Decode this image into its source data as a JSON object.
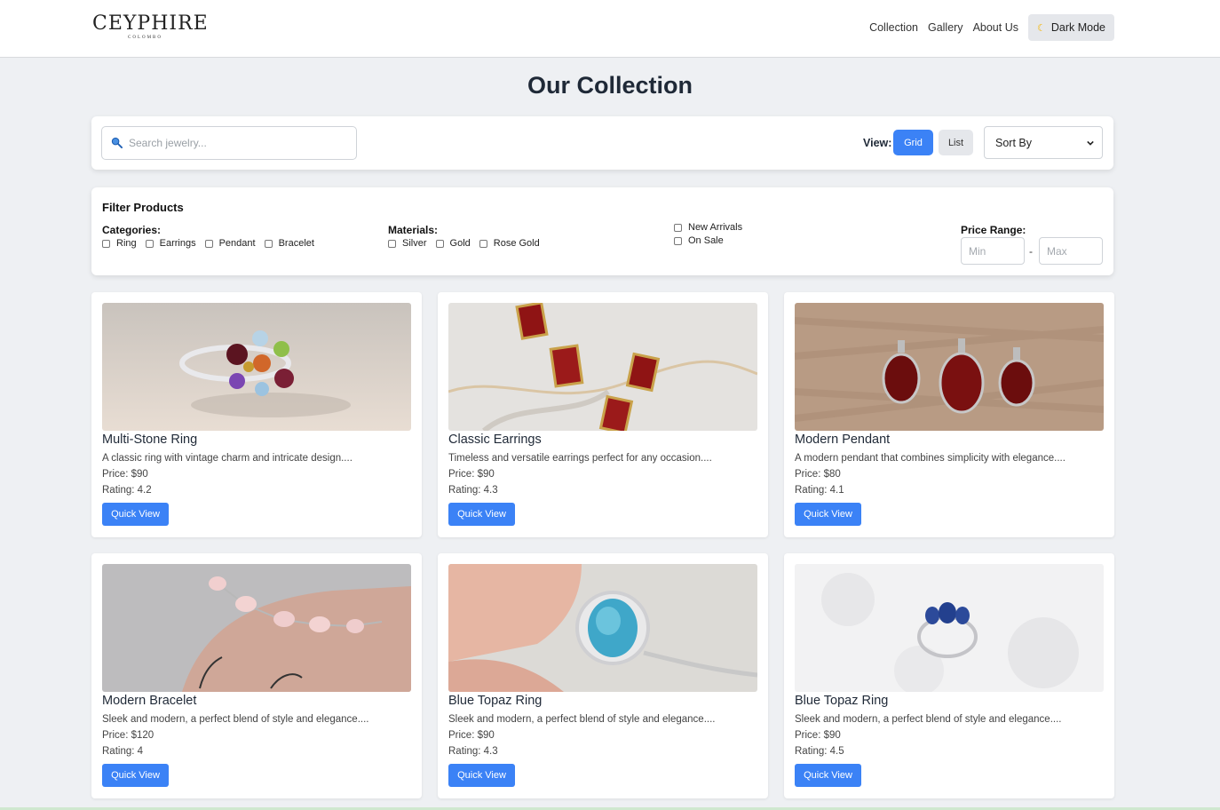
{
  "nav": {
    "logo_text": "CEYPHIRE",
    "logo_sub": "COLOMBO",
    "links": [
      "Collection",
      "Gallery",
      "About Us"
    ],
    "dark_mode_label": "Dark Mode",
    "dark_mode_icon": "moon-icon"
  },
  "page_title": "Our Collection",
  "search": {
    "placeholder": "Search jewelry...",
    "value": "",
    "icon": "search-icon"
  },
  "view": {
    "label": "View:",
    "grid_label": "Grid",
    "list_label": "List",
    "active": "Grid"
  },
  "sort": {
    "selected": "Sort By"
  },
  "filters": {
    "title": "Filter Products",
    "categories_label": "Categories:",
    "categories": [
      "Ring",
      "Earrings",
      "Pendant",
      "Bracelet"
    ],
    "materials_label": "Materials:",
    "materials": [
      "Silver",
      "Gold",
      "Rose Gold"
    ],
    "flags": [
      "New Arrivals",
      "On Sale"
    ],
    "price_label": "Price Range:",
    "min_placeholder": "Min",
    "max_placeholder": "Max",
    "separator": "-"
  },
  "products": [
    {
      "name": "Multi-Stone Ring",
      "description": "A classic ring with vintage charm and intricate design....",
      "price": "Price: $90",
      "rating": "Rating: 4.2",
      "button": "Quick View"
    },
    {
      "name": "Classic Earrings",
      "description": "Timeless and versatile earrings perfect for any occasion....",
      "price": "Price: $90",
      "rating": "Rating: 4.3",
      "button": "Quick View"
    },
    {
      "name": "Modern Pendant",
      "description": "A modern pendant that combines simplicity with elegance....",
      "price": "Price: $80",
      "rating": "Rating: 4.1",
      "button": "Quick View"
    },
    {
      "name": "Modern Bracelet",
      "description": "Sleek and modern, a perfect blend of style and elegance....",
      "price": "Price: $120",
      "rating": "Rating: 4",
      "button": "Quick View"
    },
    {
      "name": "Blue Topaz Ring",
      "description": "Sleek and modern, a perfect blend of style and elegance....",
      "price": "Price: $90",
      "rating": "Rating: 4.3",
      "button": "Quick View"
    },
    {
      "name": "Blue Topaz Ring",
      "description": "Sleek and modern, a perfect blend of style and elegance....",
      "price": "Price: $90",
      "rating": "Rating: 4.5",
      "button": "Quick View"
    }
  ],
  "colors": {
    "accent": "#3b82f6",
    "background": "#eef0f3",
    "card": "#ffffff"
  }
}
